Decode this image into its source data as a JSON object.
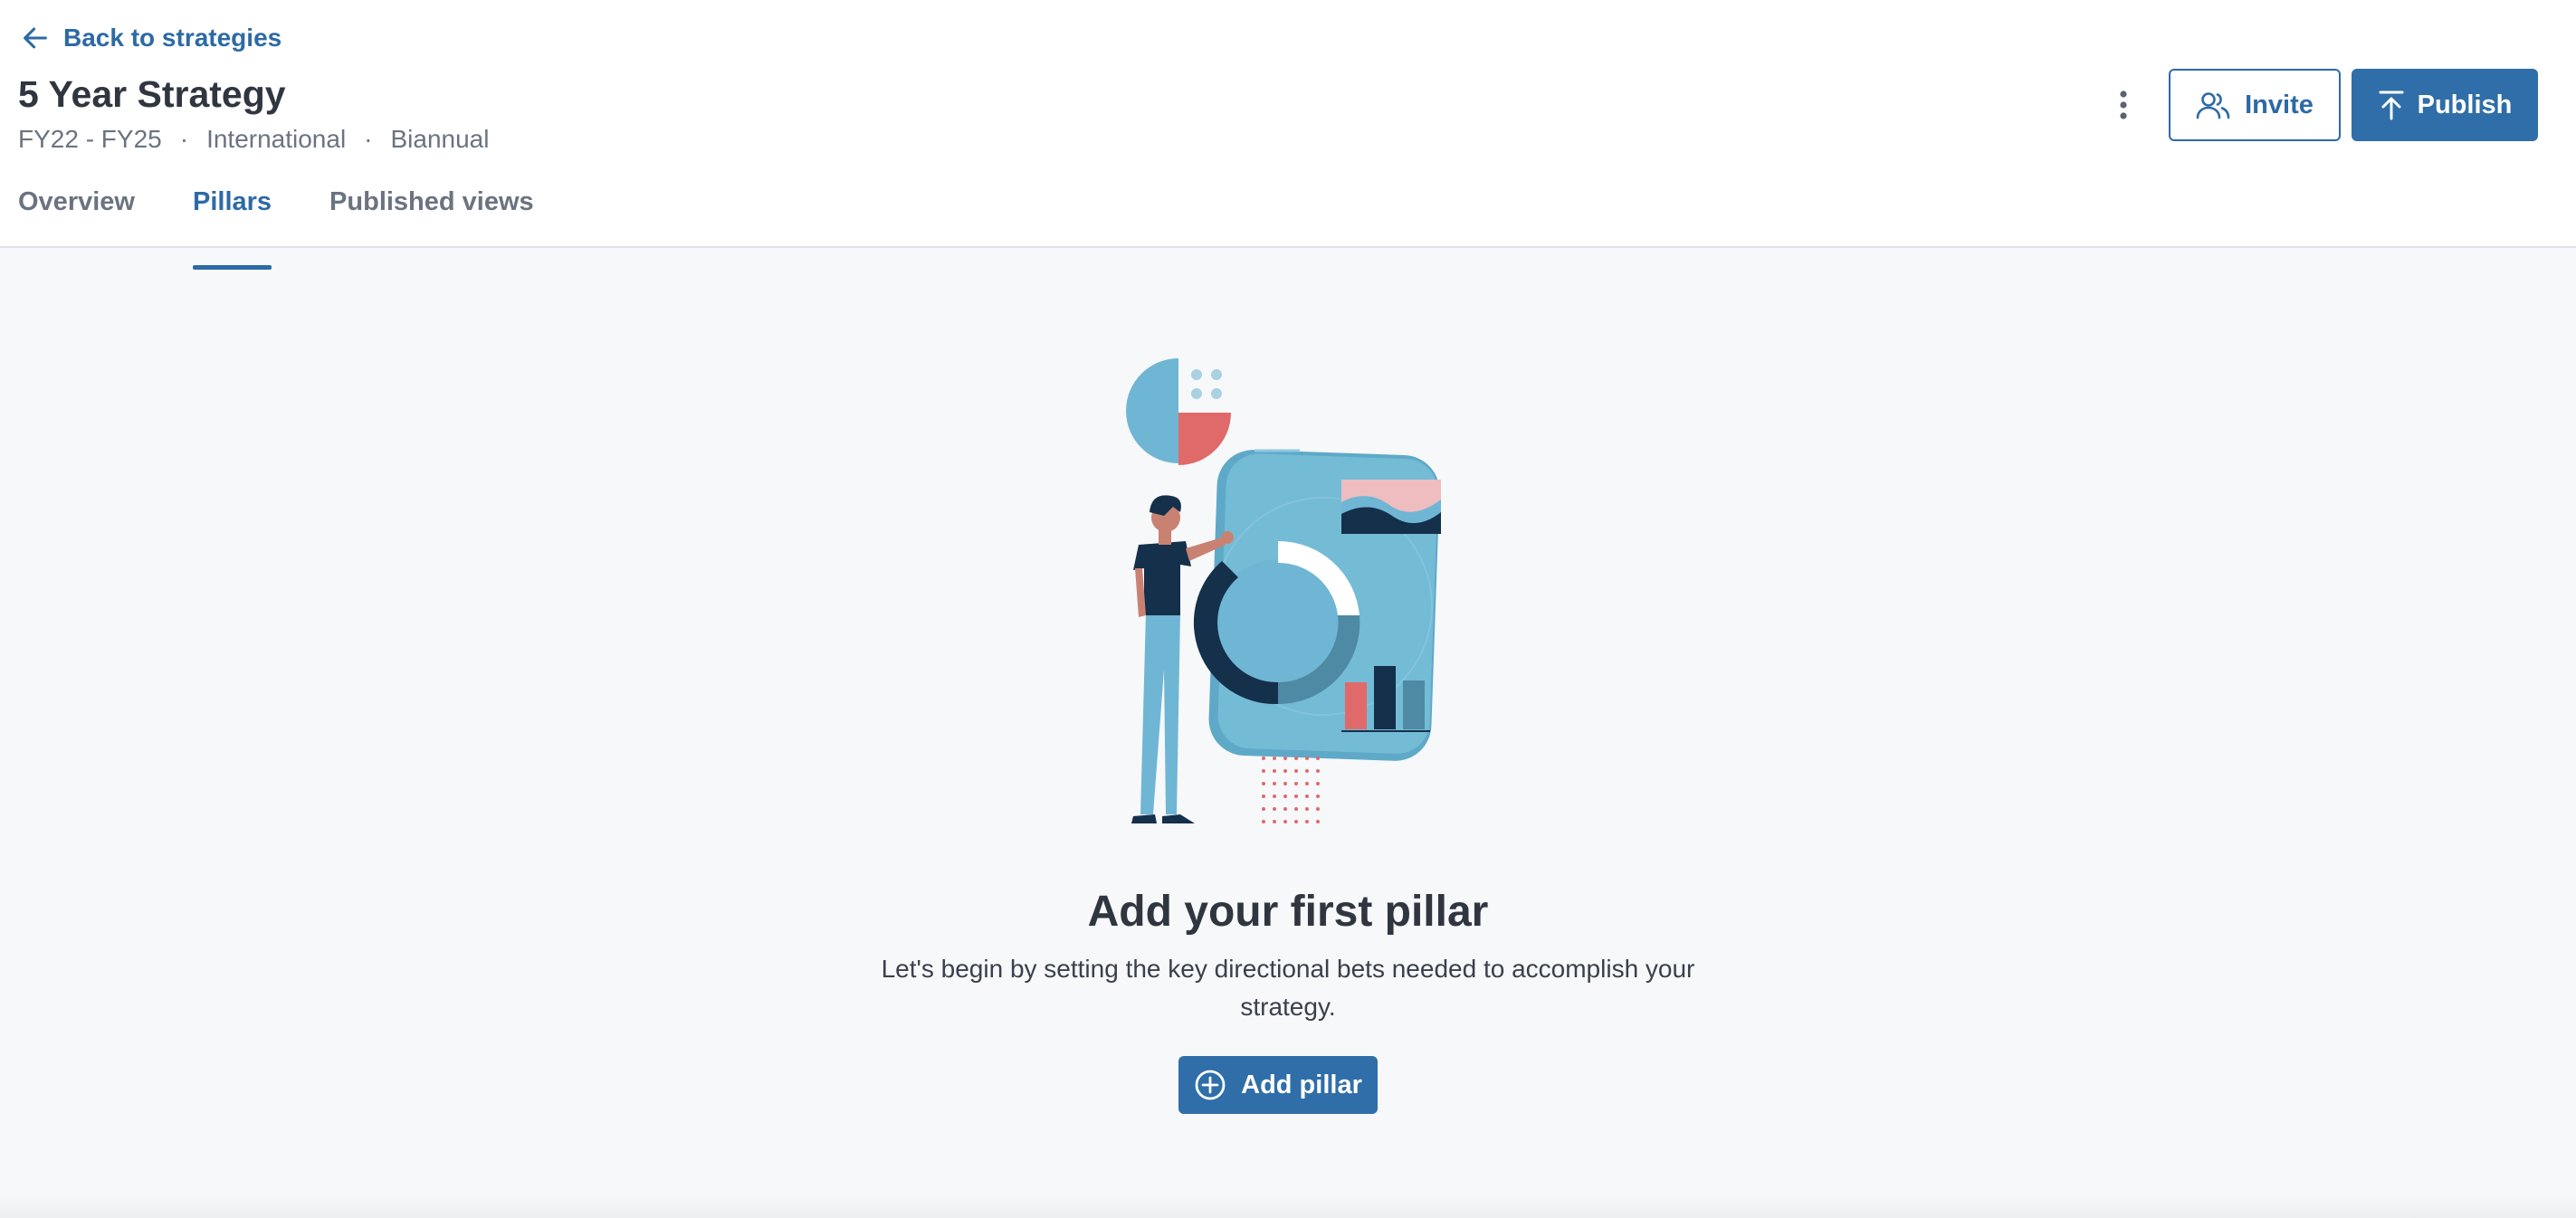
{
  "nav": {
    "back_label": "Back to strategies"
  },
  "strategy": {
    "title": "5 Year Strategy",
    "meta": [
      "FY22 - FY25",
      "International",
      "Biannual"
    ],
    "meta_separator": "·"
  },
  "tabs": [
    {
      "label": "Overview",
      "active": false
    },
    {
      "label": "Pillars",
      "active": true
    },
    {
      "label": "Published views",
      "active": false
    }
  ],
  "actions": {
    "invite_label": "Invite",
    "publish_label": "Publish"
  },
  "empty_state": {
    "title": "Add your first pillar",
    "description": "Let's begin by setting the key directional bets needed to accomplish your strategy.",
    "add_label": "Add pillar"
  },
  "icons": {
    "back": "arrow-left-icon",
    "more": "vertical-dots-icon",
    "invite": "users-icon",
    "publish": "upload-icon",
    "add": "plus-circle-icon"
  },
  "colors": {
    "primary": "#2f6ea8",
    "link": "#2d6aa6",
    "text": "#2f3640",
    "muted": "#6b7380",
    "background": "#f7f8fa",
    "illustration_light_blue": "#6fb6d4",
    "illustration_navy": "#14304a",
    "illustration_coral": "#e06a6a",
    "illustration_pink": "#efbcc0"
  }
}
